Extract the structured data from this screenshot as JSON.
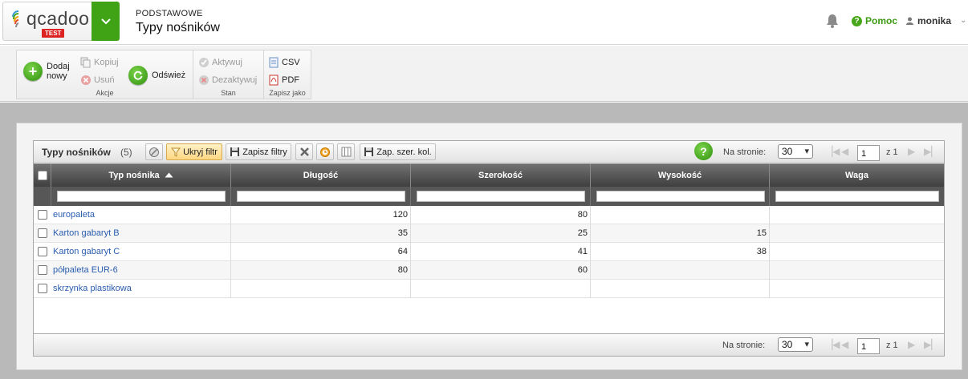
{
  "header": {
    "logo_text": "qcadoo",
    "logo_badge": "TEST",
    "breadcrumb_section": "PODSTAWOWE",
    "page_title": "Typy nośników",
    "help_label": "Pomoc",
    "user_name": "monika"
  },
  "ribbon": {
    "groups": [
      {
        "label": "Akcje"
      },
      {
        "label": "Stan"
      },
      {
        "label": "Zapisz jako"
      }
    ],
    "add_new_line1": "Dodaj",
    "add_new_line2": "nowy",
    "copy": "Kopiuj",
    "delete": "Usuń",
    "refresh": "Odśwież",
    "activate": "Aktywuj",
    "deactivate": "Dezaktywuj",
    "csv": "CSV",
    "pdf": "PDF"
  },
  "grid": {
    "title": "Typy nośników",
    "count": "(5)",
    "hide_filter": "Ukryj filtr",
    "save_filters": "Zapisz filtry",
    "save_columns": "Zap. szer. kol.",
    "per_page_label": "Na stronie:",
    "per_page_value": "30",
    "current_page": "1",
    "of_pages": "z 1",
    "columns": [
      "Typ nośnika",
      "Długość",
      "Szerokość",
      "Wysokość",
      "Waga"
    ],
    "rows": [
      {
        "name": "europaleta",
        "length": "120",
        "width": "80",
        "height": "",
        "weight": ""
      },
      {
        "name": "Karton gabaryt B",
        "length": "35",
        "width": "25",
        "height": "15",
        "weight": ""
      },
      {
        "name": "Karton gabaryt C",
        "length": "64",
        "width": "41",
        "height": "38",
        "weight": ""
      },
      {
        "name": "półpaleta EUR-6",
        "length": "80",
        "width": "60",
        "height": "",
        "weight": ""
      },
      {
        "name": "skrzynka plastikowa",
        "length": "",
        "width": "",
        "height": "",
        "weight": ""
      }
    ]
  },
  "colors": {
    "brand_green": "#3fa315",
    "link_blue": "#2a5db0",
    "header_dark": "#4a4a4a",
    "page_grey": "#b9b9b9"
  }
}
